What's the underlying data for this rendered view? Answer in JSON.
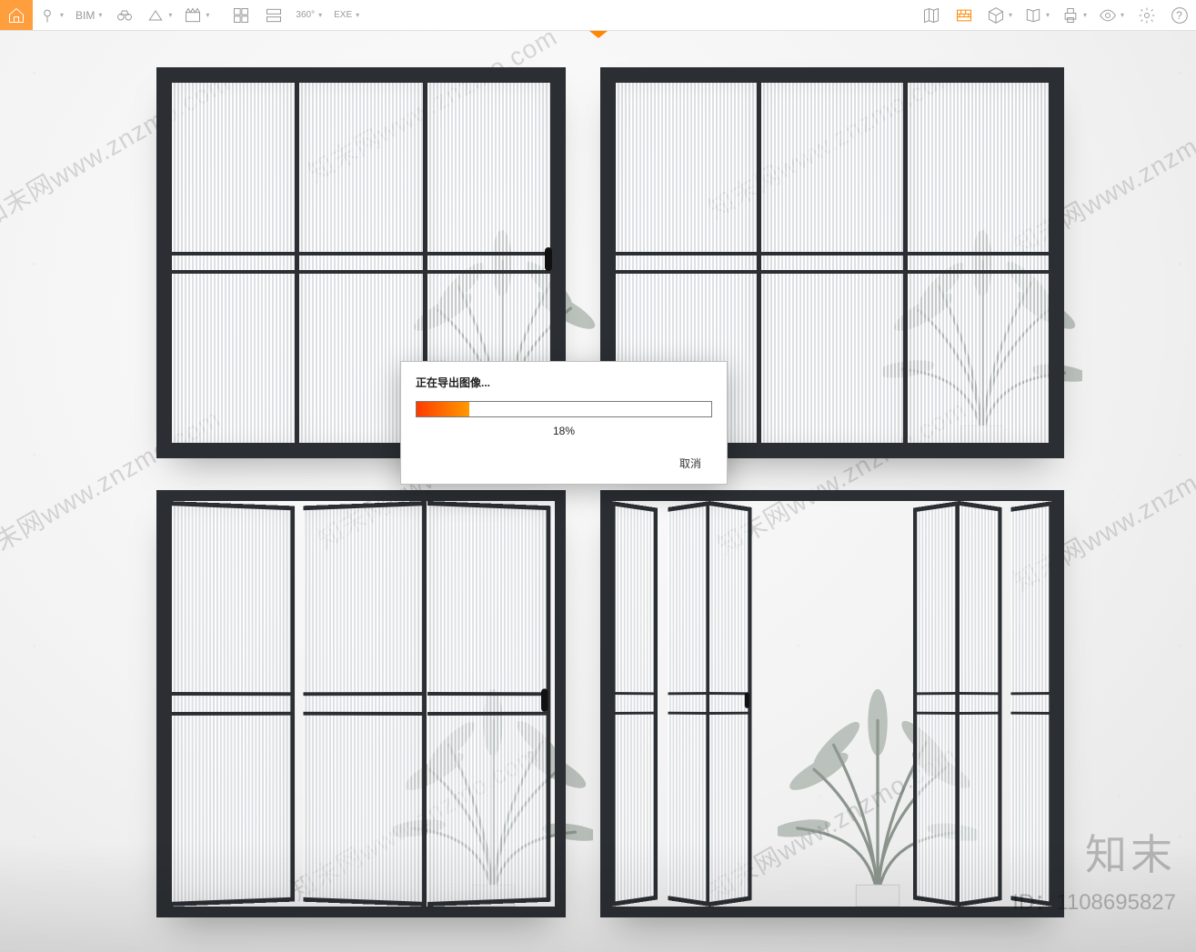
{
  "toolbar": {
    "left": {
      "home": "home-icon",
      "pin": "pin-icon",
      "bim_label": "BIM",
      "binoculars": "binoculars-icon",
      "section": "section-icon",
      "clapper": "clapper-icon",
      "layers_a": "tile-a-icon",
      "layers_b": "tile-b-icon",
      "deg_label": "360°",
      "exe_label": "EXE"
    },
    "right": {
      "map": "map-icon",
      "wall": "wall-icon",
      "cube": "cube-icon",
      "book": "book-icon",
      "print": "print-icon",
      "eye": "eye-icon",
      "gear": "gear-icon",
      "help": "?"
    }
  },
  "dialog": {
    "title": "正在导出图像...",
    "percent_value": 18,
    "percent_label": "18%",
    "cancel_label": "取消"
  },
  "watermark": {
    "text": "知末网www.znzmo.com",
    "brand_name": "知末",
    "brand_id": "ID：1108695827"
  },
  "scene": {
    "frame_color": "#2b2f33",
    "glass_pattern": "reeded",
    "units": [
      {
        "id": "top-left-folding-closed"
      },
      {
        "id": "top-right-sliding"
      },
      {
        "id": "bottom-left-folding-partial"
      },
      {
        "id": "bottom-right-folding-open"
      }
    ]
  }
}
